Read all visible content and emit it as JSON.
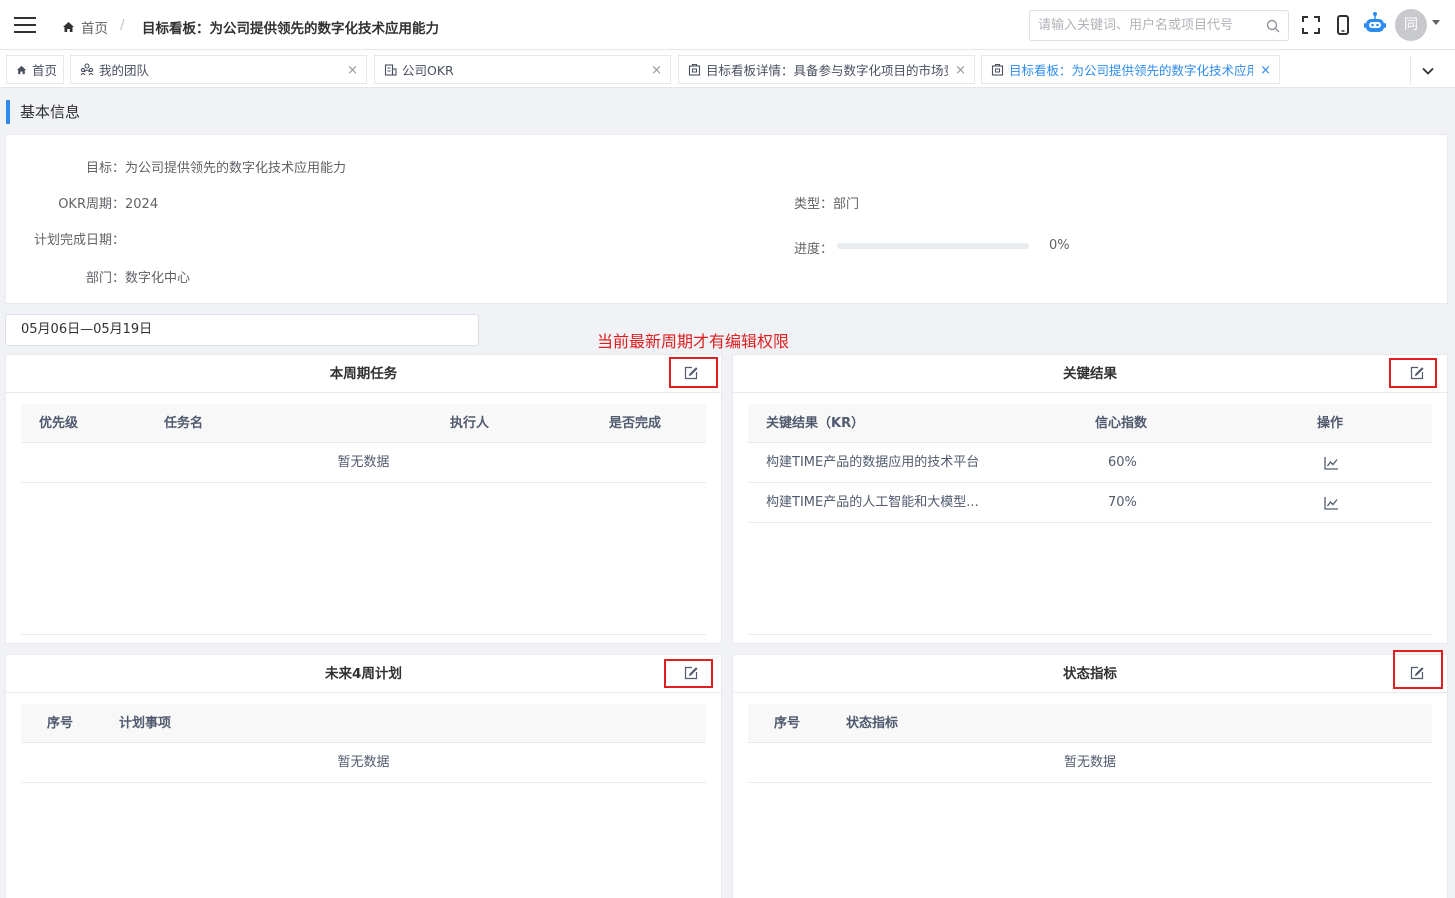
{
  "header": {
    "home": "首页",
    "separator": "/",
    "current": "目标看板：为公司提供领先的数字化技术应用能力",
    "search_placeholder": "请输入关键词、用户名或项目代号",
    "avatar_text": "同"
  },
  "tabs": [
    {
      "label": "首页",
      "icon": "home-icon",
      "closable": false,
      "active": false
    },
    {
      "label": "我的团队",
      "icon": "team-icon",
      "closable": true,
      "active": false
    },
    {
      "label": "公司OKR",
      "icon": "building-icon",
      "closable": true,
      "active": false
    },
    {
      "label": "目标看板详情：具备参与数字化项目的市场竞",
      "icon": "board-icon",
      "closable": true,
      "active": false
    },
    {
      "label": "目标看板：为公司提供领先的数字化技术应用能",
      "icon": "board-icon",
      "closable": true,
      "active": true
    }
  ],
  "tab_close": "×",
  "basic_info": {
    "title": "基本信息",
    "goal_label": "目标：",
    "goal": "为公司提供领先的数字化技术应用能力",
    "cycle_label": "OKR周期：",
    "cycle": "2024",
    "type_label": "类型：",
    "type": "部门",
    "plan_date_label": "计划完成日期：",
    "plan_date": "",
    "progress_label": "进度：",
    "progress_text": "0%",
    "progress_value": 0,
    "dept_label": "部门：",
    "dept": "数字化中心"
  },
  "date_range": "05月06日—05月19日",
  "annotation": "当前最新周期才有编辑权限",
  "panels": {
    "tasks": {
      "title": "本周期任务",
      "columns": [
        "优先级",
        "任务名",
        "执行人",
        "是否完成"
      ],
      "empty": "暂无数据"
    },
    "key_results": {
      "title": "关键结果",
      "columns": [
        "关键结果（KR）",
        "信心指数",
        "操作"
      ],
      "rows": [
        {
          "name": "构建TIME产品的数据应用的技术平台",
          "confidence": "60%",
          "action_icon": "chart-icon"
        },
        {
          "name": "构建TIME产品的人工智能和大模型...",
          "confidence": "70%",
          "action_icon": "chart-icon"
        }
      ]
    },
    "future_plan": {
      "title": "未来4周计划",
      "columns": [
        "序号",
        "计划事项"
      ],
      "empty": "暂无数据"
    },
    "status": {
      "title": "状态指标",
      "columns": [
        "序号",
        "状态指标"
      ],
      "empty": "暂无数据"
    }
  },
  "colors": {
    "accent": "#2d8cf0",
    "annotation": "#e02020"
  }
}
